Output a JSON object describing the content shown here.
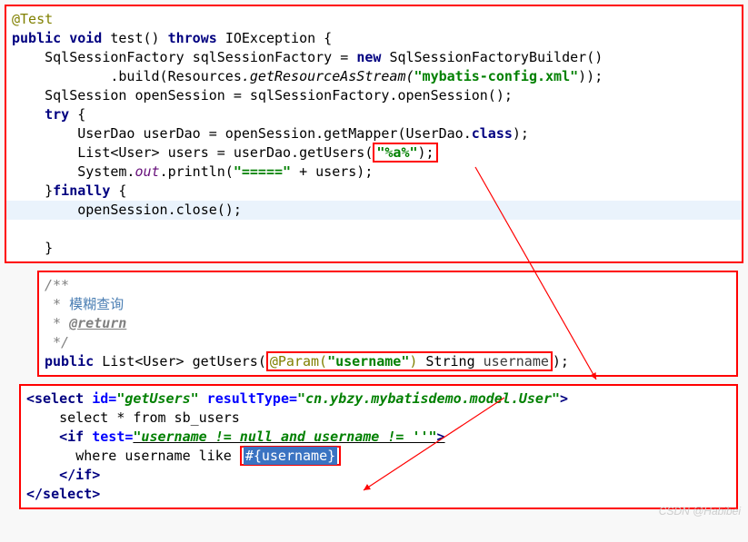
{
  "box1": {
    "anno_test": "@Test",
    "kw_public": "public",
    "kw_void": "void",
    "fn_test": "test",
    "kw_throws": "throws",
    "ex": "IOException",
    "lbrace": " {",
    "t_factory": "SqlSessionFactory",
    "v_factory": "sqlSessionFactory",
    "eq": " = ",
    "kw_new": "new",
    "t_builder": "SqlSessionFactoryBuilder",
    "call_empty": "()",
    "dot_build": ".build(Resources",
    "getRes": ".getResourceAsStream(",
    "str_config": "\"mybatis-config.xml\"",
    "close2": "));",
    "t_session": "SqlSession",
    "v_session": "openSession",
    "openSession_call": " = sqlSessionFactory.openSession();",
    "kw_try": "try",
    "t_userdao": "UserDao",
    "v_userdao": "userDao",
    "getMapper": " = openSession.getMapper(UserDao.",
    "kw_class": "class",
    "close1": ");",
    "t_list": "List<User>",
    "v_users": "users",
    "getUsers": " = userDao.getUsers(",
    "str_pattern": "\"%a%\"",
    "sys": "System.",
    "out": "out",
    "println": ".println(",
    "str_eq": "\"=====\"",
    "plus_users": " + users);",
    "rbrace": "}",
    "kw_finally": "finally",
    "close_call": "openSession.close();"
  },
  "box2": {
    "c_start": "/**",
    "c_star": " * ",
    "c_fuzzy": "模糊查询",
    "c_return_tag": "@return",
    "c_end": " */",
    "kw_public": "public",
    "t_return": "List<User>",
    "m_name": "getUsers",
    "lparen": "(",
    "anno_param": "@Param(",
    "str_username": "\"username\"",
    "rparen_anno": ")",
    "t_string": " String ",
    "v_username": "username",
    "end": ");"
  },
  "box3": {
    "sel_open": "<select",
    "id_attr": " id=",
    "id_val": "\"getUsers\"",
    "rt_attr": " resultType=",
    "rt_val": "\"cn.ybzy.mybatisdemo.model.User\"",
    "gt": ">",
    "sql1": "select * from sb_users",
    "if_open": "<if",
    "test_attr": " test=",
    "test_val": "\"username != null and username != ''\"",
    "sql2": "where username like ",
    "placeholder": "#{username}",
    "if_close": "</if>",
    "sel_close": "</select>"
  },
  "watermark": "CSDN @Habibei"
}
